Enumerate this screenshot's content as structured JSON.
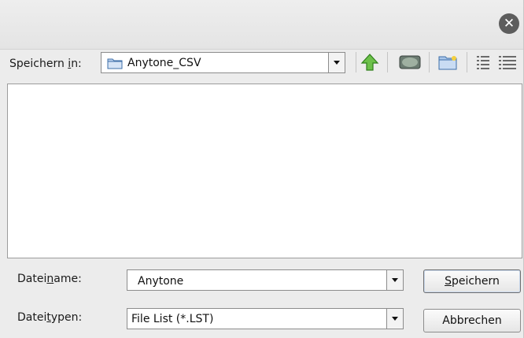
{
  "dialog": {
    "close_icon": "close-icon",
    "save_in": {
      "label_before": "Speichern ",
      "label_mnemonic": "i",
      "label_after": "n:",
      "value": "Anytone_CSV",
      "folder_icon": "folder-icon"
    },
    "toolbar": {
      "icons": [
        "up-one-level-icon",
        "desktop-icon",
        "new-folder-icon",
        "list-view-icon",
        "details-view-icon"
      ]
    },
    "file_list": {
      "items": []
    },
    "filename": {
      "label_before": "Datei",
      "label_mnemonic": "n",
      "label_after": "ame:",
      "value": "Anytone"
    },
    "filetype": {
      "label_before": "Datei",
      "label_mnemonic": "t",
      "label_after": "ypen:",
      "value": "File List (*.LST)"
    },
    "buttons": {
      "save_mnemonic": "S",
      "save_rest": "peichern",
      "cancel": "Abbrechen"
    }
  }
}
